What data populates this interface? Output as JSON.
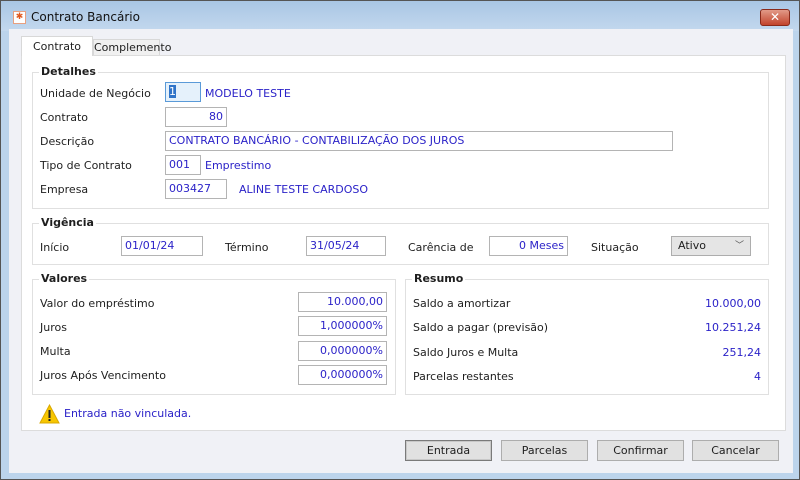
{
  "window": {
    "title": "Contrato Bancário",
    "close_icon": "close-icon"
  },
  "tabs": [
    {
      "label": "Contrato",
      "selected": true
    },
    {
      "label": "Complemento",
      "selected": false
    }
  ],
  "detalhes": {
    "title": "Detalhes",
    "unidade_label": "Unidade de Negócio",
    "unidade_value": "1",
    "unidade_name": "MODELO TESTE",
    "contrato_label": "Contrato",
    "contrato_value": "80",
    "descricao_label": "Descrição",
    "descricao_value": "CONTRATO BANCÁRIO - CONTABILIZAÇÃO DOS JUROS",
    "tipo_label": "Tipo de Contrato",
    "tipo_value": "001",
    "tipo_name": "Emprestimo",
    "empresa_label": "Empresa",
    "empresa_value": "003427",
    "empresa_name": "ALINE TESTE CARDOSO"
  },
  "vigencia": {
    "title": "Vigência",
    "inicio_label": "Início",
    "inicio_value": "01/01/24",
    "termino_label": "Término",
    "termino_value": "31/05/24",
    "carencia_label": "Carência de",
    "carencia_value": "0 Meses",
    "situacao_label": "Situação",
    "situacao_value": "Ativo"
  },
  "valores": {
    "title": "Valores",
    "rows": [
      {
        "label": "Valor do empréstimo",
        "value": "10.000,00"
      },
      {
        "label": "Juros",
        "value": "1,000000%"
      },
      {
        "label": "Multa",
        "value": "0,000000%"
      },
      {
        "label": "Juros Após Vencimento",
        "value": "0,000000%"
      }
    ]
  },
  "resumo": {
    "title": "Resumo",
    "rows": [
      {
        "label": "Saldo a amortizar",
        "value": "10.000,00"
      },
      {
        "label": "Saldo a pagar (previsão)",
        "value": "10.251,24"
      },
      {
        "label": "Saldo Juros e Multa",
        "value": "251,24"
      },
      {
        "label": "Parcelas restantes",
        "value": "4"
      }
    ]
  },
  "warning": {
    "text": "Entrada não vinculada.",
    "icon": "warning-icon"
  },
  "buttons": {
    "entrada": "Entrada",
    "parcelas": "Parcelas",
    "confirmar": "Confirmar",
    "cancelar": "Cancelar"
  },
  "colors": {
    "value_text": "#2b22c8",
    "close_button": "#c2442c"
  }
}
